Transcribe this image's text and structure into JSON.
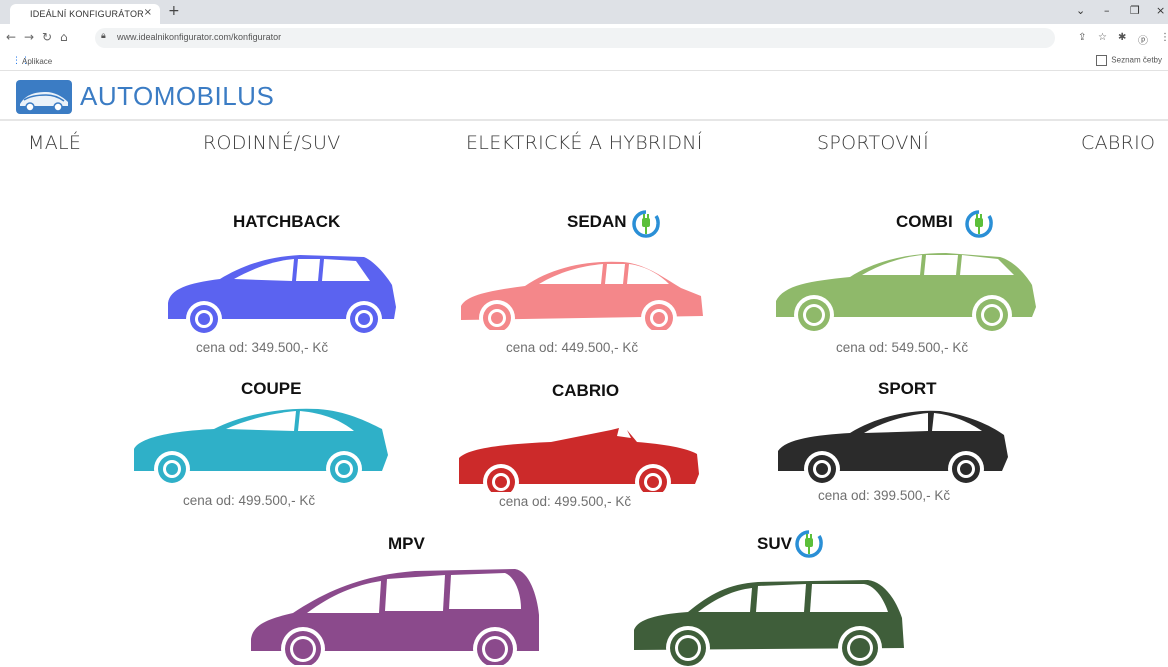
{
  "browser": {
    "tab_title": "IDEÁLNÍ KONFIGURÁTOR",
    "tab_close": "×",
    "new_tab": "+",
    "url": "www.idealnikonfigurator.com/konfigurator",
    "bookmarks_apps": "Aplikace",
    "reading_list": "Seznam četby"
  },
  "site": {
    "logo_text": "AUTOMOBILUS",
    "brand_color": "#3b7cc4"
  },
  "nav": {
    "items": [
      "MALÉ",
      "RODINNÉ/SUV",
      "ELEKTRICKÉ A HYBRIDNÍ",
      "SPORTOVNÍ",
      "CABRIO"
    ]
  },
  "cars": [
    {
      "name": "HATCHBACK",
      "price": "cena od: 349.500,- Kč",
      "color": "#5b63f0",
      "electric": false
    },
    {
      "name": "SEDAN",
      "price": "cena od: 449.500,- Kč",
      "color": "#f4878a",
      "electric": true
    },
    {
      "name": "COMBI",
      "price": "cena od: 549.500,- Kč",
      "color": "#8fb96a",
      "electric": true
    },
    {
      "name": "COUPE",
      "price": "cena od: 499.500,- Kč",
      "color": "#2fb0c8",
      "electric": false
    },
    {
      "name": "CABRIO",
      "price": "cena od: 499.500,- Kč",
      "color": "#cc2a2a",
      "electric": false
    },
    {
      "name": "SPORT",
      "price": "cena od: 399.500,- Kč",
      "color": "#2b2b2b",
      "electric": false
    },
    {
      "name": "MPV",
      "price": "",
      "color": "#8b4a8c",
      "electric": false
    },
    {
      "name": "SUV",
      "price": "",
      "color": "#3f5e3a",
      "electric": true
    }
  ],
  "icons": {
    "electric": "plug-icon",
    "electric_color": "#2a8fd6",
    "electric_plug_color": "#5cbf3a"
  }
}
